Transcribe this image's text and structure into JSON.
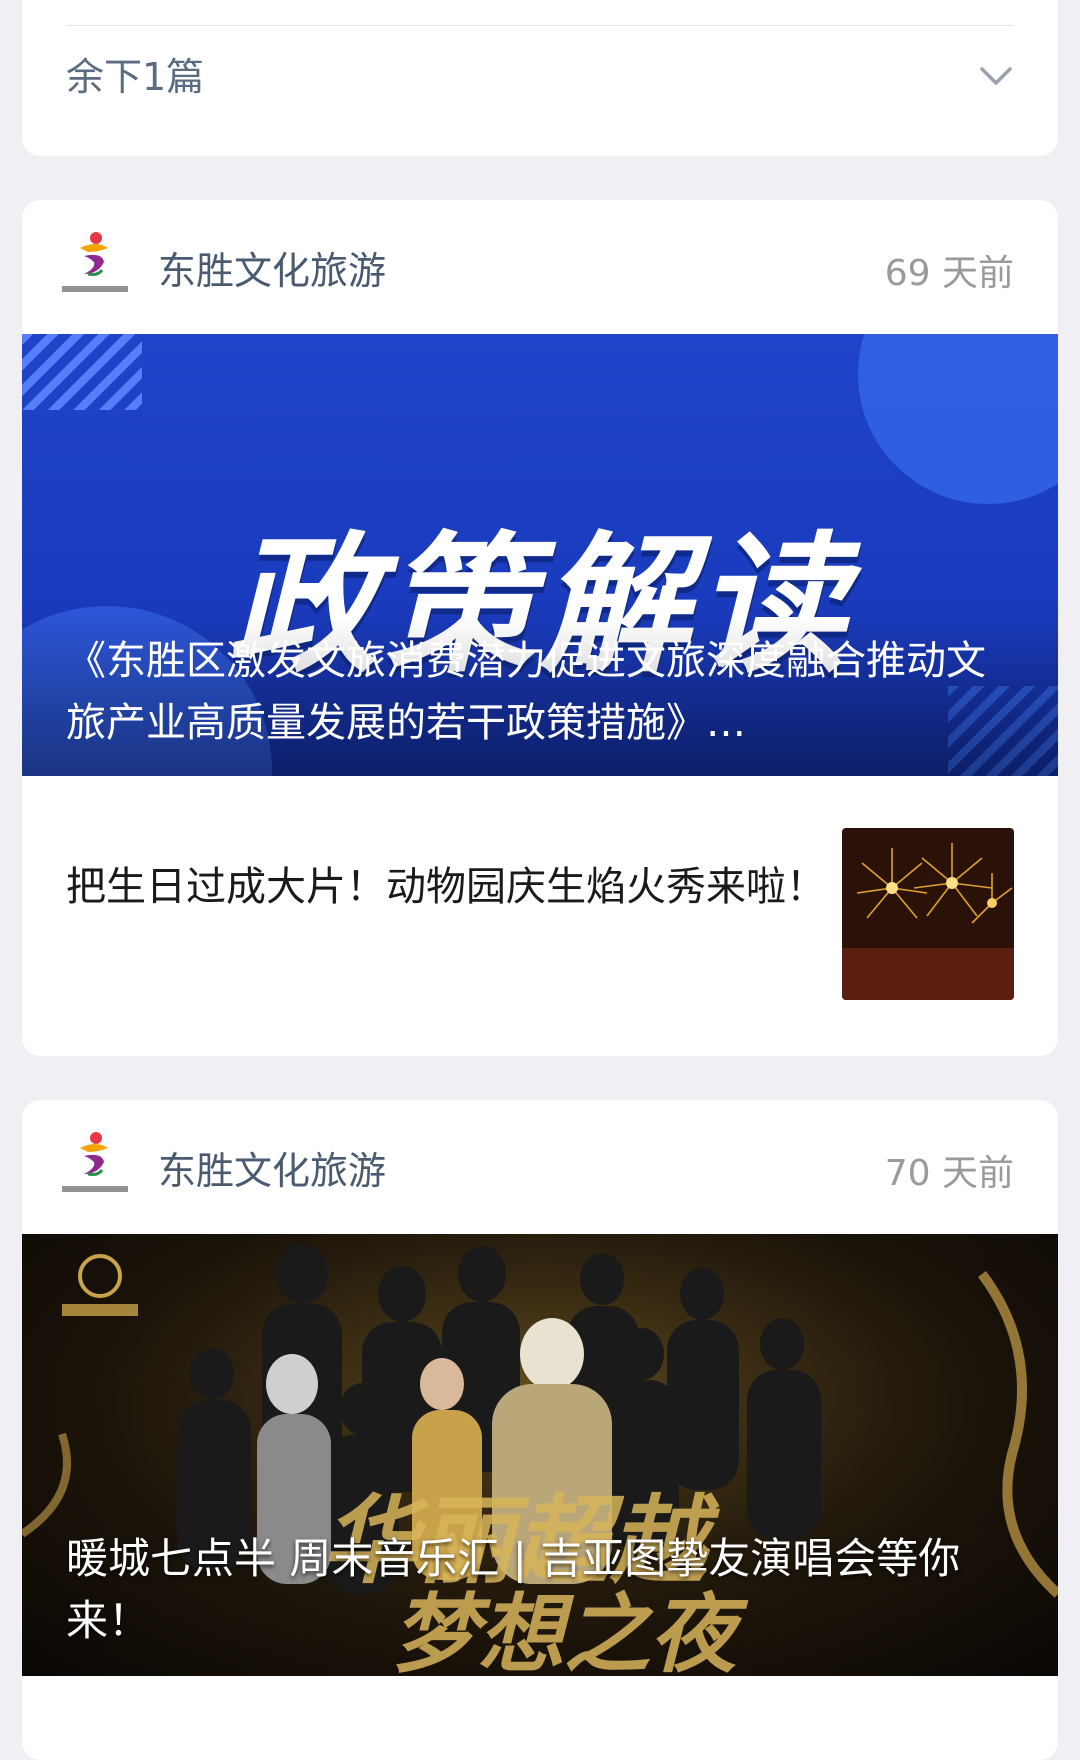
{
  "collapsed_card": {
    "remaining_label": "余下1篇"
  },
  "articles": [
    {
      "account_name": "东胜文化旅游",
      "time_ago": "69 天前",
      "hero": {
        "headline": "政策解读",
        "caption": "《东胜区激发文旅消费潜力促进文旅深度融合推动文旅产业高质量发展的若干政策措施》…"
      },
      "sub_item": {
        "title": "把生日过成大片！动物园庆生焰火秀来啦！"
      }
    },
    {
      "account_name": "东胜文化旅游",
      "time_ago": "70 天前",
      "hero": {
        "caption": "暖城七点半 周末音乐汇 | 吉亚图挚友演唱会等你来！"
      }
    }
  ],
  "colors": {
    "page_bg": "#efeff4",
    "card_bg": "#ffffff",
    "account_name": "#4a5a70",
    "policy_banner": "#1f44c9"
  },
  "icons": {
    "expand": "chevron-down-icon",
    "account_logo": "dongsheng-logo-icon"
  }
}
